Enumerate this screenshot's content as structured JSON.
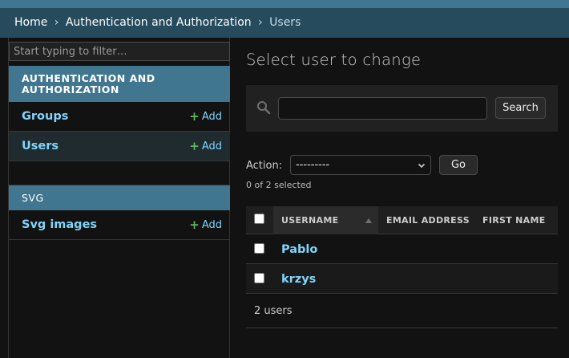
{
  "breadcrumb": {
    "home": "Home",
    "sep": "›",
    "app": "Authentication and Authorization",
    "current": "Users"
  },
  "sidebar": {
    "filter_placeholder": "Start typing to filter…",
    "apps": [
      {
        "caption": "AUTHENTICATION AND AUTHORIZATION",
        "models": [
          {
            "name": "Groups",
            "add_label": "Add"
          },
          {
            "name": "Users",
            "add_label": "Add",
            "selected": true
          }
        ]
      },
      {
        "caption": "SVG",
        "models": [
          {
            "name": "Svg images",
            "add_label": "Add"
          }
        ]
      }
    ]
  },
  "main": {
    "title": "Select user to change",
    "search": {
      "value": "",
      "button_label": "Search",
      "icon": "search-icon"
    },
    "actions": {
      "label": "Action:",
      "selected": "---------",
      "go_label": "Go",
      "selected_count": "0 of 2 selected"
    },
    "table": {
      "columns": [
        "USERNAME",
        "EMAIL ADDRESS",
        "FIRST NAME"
      ],
      "sorted_column": "USERNAME",
      "sort_direction": "ascending",
      "rows": [
        {
          "username": "Pablo"
        },
        {
          "username": "krzys"
        }
      ],
      "paginator": "2 users"
    }
  },
  "colors": {
    "header": "#264b5d",
    "caption": "#417690",
    "link": "#81d4fa",
    "add_plus": "#5cb85c",
    "background": "#121212"
  }
}
